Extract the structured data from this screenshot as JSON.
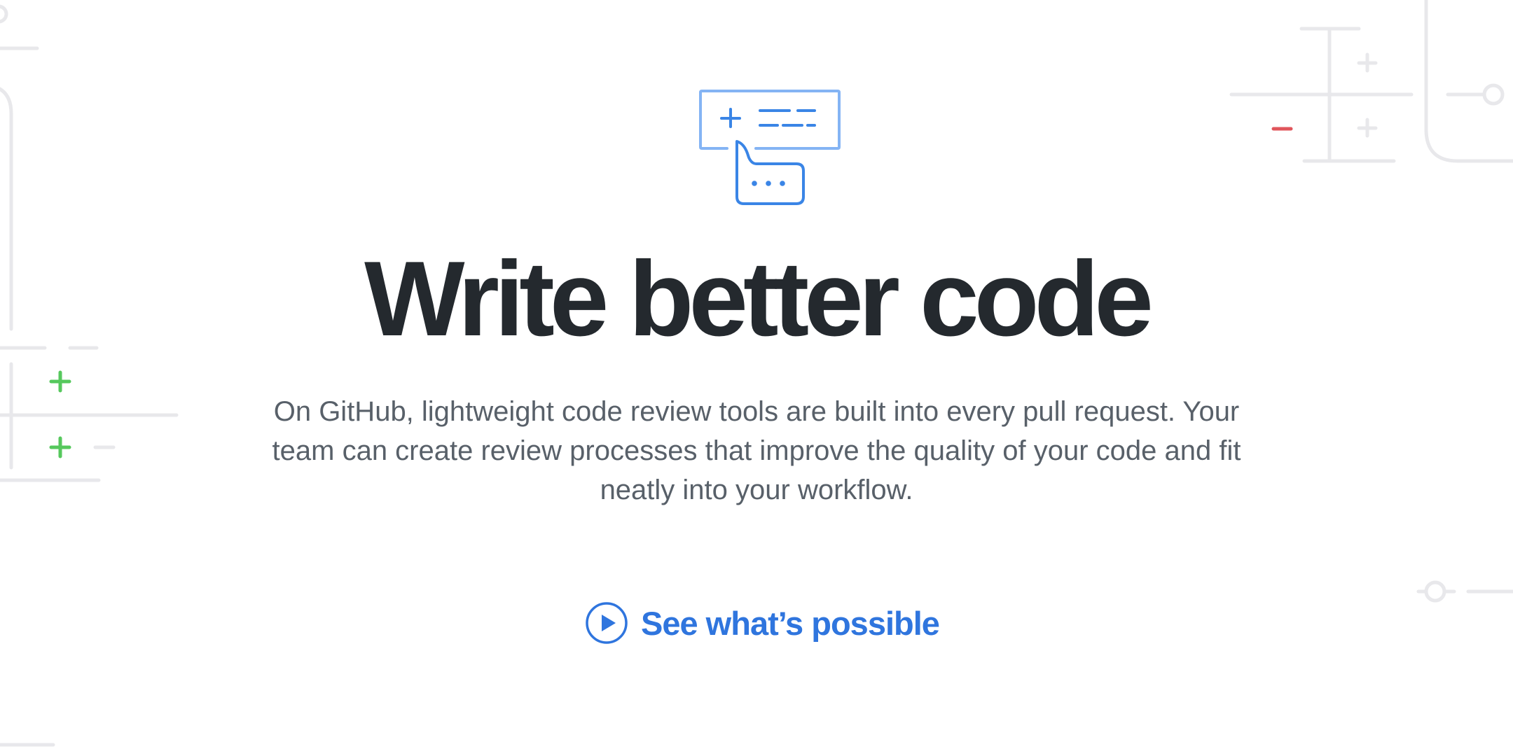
{
  "hero": {
    "icon": "code-review-comment-icon",
    "headline": "Write better code",
    "description": "On GitHub, lightweight code review tools are built into every pull request. Your team can create review processes that improve the quality of your code and fit neatly into your workflow.",
    "cta": {
      "label": "See what’s possible",
      "icon": "play-circle-icon"
    }
  },
  "colors": {
    "heading": "#24292e",
    "body_text": "#586069",
    "link": "#2f75de",
    "icon_blue": "#4a8de8",
    "decor_gray": "#e8e8eb",
    "addition_green": "#56c85d",
    "deletion_red": "#e0555b"
  }
}
